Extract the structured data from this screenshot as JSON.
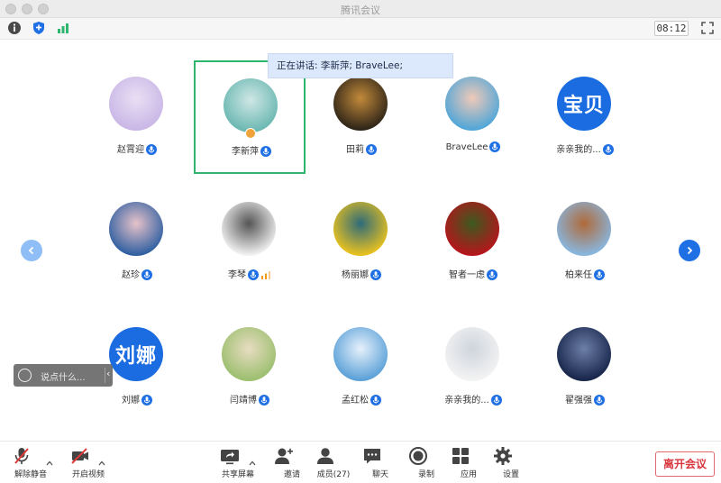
{
  "window": {
    "title": "腾讯会议"
  },
  "statusbar": {
    "timer": "08:12",
    "icons": [
      "info-icon",
      "shield-icon",
      "signal-icon",
      "fullscreen-icon"
    ]
  },
  "speaking": {
    "text": "正在讲话: 李新萍; BraveLee;"
  },
  "participants": [
    {
      "name": "赵霄迎",
      "avatar": "photo",
      "colors": [
        "#c9b6e6",
        "#e9dff4"
      ],
      "mic": "on"
    },
    {
      "name": "李新萍",
      "avatar": "photo",
      "colors": [
        "#6ab7b1",
        "#cfe7e6"
      ],
      "mic": "on",
      "active": true,
      "host": true
    },
    {
      "name": "田莉",
      "avatar": "photo",
      "colors": [
        "#2e2418",
        "#c28a3a"
      ],
      "mic": "on"
    },
    {
      "name": "BraveLee",
      "avatar": "photo",
      "colors": [
        "#4fa6d8",
        "#f0c9b8"
      ],
      "mic": "on"
    },
    {
      "name": "亲亲我的...",
      "avatar": "text",
      "avatar_text": "宝贝",
      "colors": [
        "#1a6ce0",
        "#1a6ce0"
      ],
      "mic": "on"
    },
    {
      "name": "赵珍",
      "avatar": "photo",
      "colors": [
        "#2f5fa1",
        "#e6c2c9"
      ],
      "mic": "on"
    },
    {
      "name": "李琴",
      "avatar": "photo",
      "colors": [
        "#f2f2f2",
        "#555555"
      ],
      "mic": "on",
      "speaking": true
    },
    {
      "name": "杨丽娜",
      "avatar": "photo",
      "colors": [
        "#e9c21f",
        "#2f6a7a"
      ],
      "mic": "on"
    },
    {
      "name": "智者一虑",
      "avatar": "photo",
      "colors": [
        "#b6151b",
        "#3c5a1e"
      ],
      "mic": "on"
    },
    {
      "name": "柏来任",
      "avatar": "photo",
      "colors": [
        "#88b7e0",
        "#b06a3a"
      ],
      "mic": "on"
    },
    {
      "name": "刘娜",
      "avatar": "text",
      "avatar_text": "刘娜",
      "colors": [
        "#1a6ce0",
        "#1a6ce0"
      ],
      "mic": "on"
    },
    {
      "name": "闫靖博",
      "avatar": "photo",
      "colors": [
        "#9bbf6e",
        "#e8dcc1"
      ],
      "mic": "on"
    },
    {
      "name": "孟红松",
      "avatar": "photo",
      "colors": [
        "#5aa0d8",
        "#e7f1fb"
      ],
      "mic": "on"
    },
    {
      "name": "亲亲我的...",
      "avatar": "photo",
      "colors": [
        "#f3f3f3",
        "#cfd5dc"
      ],
      "mic": "on"
    },
    {
      "name": "翟强强",
      "avatar": "photo",
      "colors": [
        "#17254a",
        "#6d7fa8"
      ],
      "mic": "on"
    }
  ],
  "chat": {
    "placeholder": "说点什么..."
  },
  "toolbar": {
    "unmute": "解除静音",
    "start_video": "开启视频",
    "share_screen": "共享屏幕",
    "invite": "邀请",
    "members": "成员(27)",
    "chat": "聊天",
    "record": "录制",
    "apps": "应用",
    "settings": "设置",
    "leave": "离开会议"
  },
  "colors": {
    "accent_blue": "#1f6fe5",
    "active_border": "#2eb56e",
    "leave_red": "#d9363e",
    "host_orange": "#f0a33a"
  }
}
